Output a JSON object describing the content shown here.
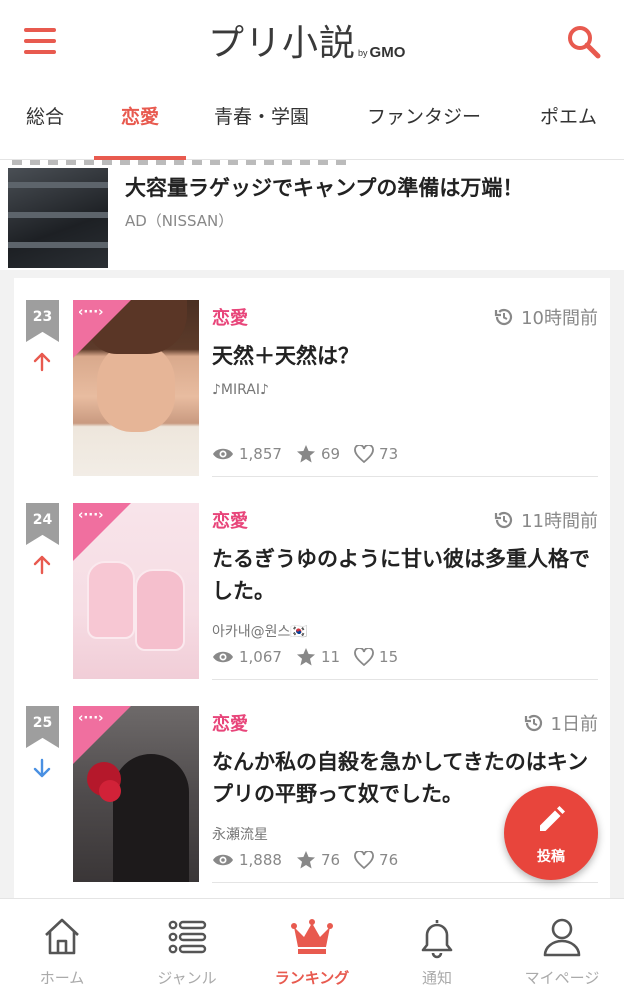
{
  "header": {
    "logo_text": "プリ小説",
    "logo_by": "by",
    "logo_brand": "GMO",
    "menu_icon": "hamburger-menu-icon",
    "search_icon": "search-icon"
  },
  "tabs": [
    {
      "label": "総合",
      "active": false
    },
    {
      "label": "恋愛",
      "active": true
    },
    {
      "label": "青春・学園",
      "active": false
    },
    {
      "label": "ファンタジー",
      "active": false
    },
    {
      "label": "ポエム",
      "active": false
    }
  ],
  "ad": {
    "title": "大容量ラゲッジでキャンプの準備は万端！",
    "source": "AD（NISSAN）"
  },
  "rankings": [
    {
      "rank": "23",
      "trend": "up",
      "category": "恋愛",
      "time": "10時間前",
      "title": "天然＋天然は？",
      "author": "♪MIRAI♪",
      "views": "1,857",
      "stars": "69",
      "likes": "73"
    },
    {
      "rank": "24",
      "trend": "up",
      "category": "恋愛",
      "time": "11時間前",
      "title": "たるぎうゆのように甘い彼は多重人格でした。",
      "author": "아카내@원스🇰🇷",
      "views": "1,067",
      "stars": "11",
      "likes": "15"
    },
    {
      "rank": "25",
      "trend": "down",
      "category": "恋愛",
      "time": "1日前",
      "title": "なんか私の自殺を急かしてきたのはキンプリの平野って奴でした。",
      "author": "永瀬流星",
      "views": "1,888",
      "stars": "76",
      "likes": "76"
    }
  ],
  "fab": {
    "label": "投稿",
    "icon": "pencil-icon"
  },
  "bottom_nav": [
    {
      "label": "ホーム",
      "icon": "home-icon",
      "active": false
    },
    {
      "label": "ジャンル",
      "icon": "list-icon",
      "active": false
    },
    {
      "label": "ランキング",
      "icon": "crown-icon",
      "active": true
    },
    {
      "label": "通知",
      "icon": "bell-icon",
      "active": false
    },
    {
      "label": "マイページ",
      "icon": "user-icon",
      "active": false
    }
  ],
  "colors": {
    "accent": "#e85a4f",
    "category": "#e8457a",
    "rank_badge": "#9e9e9e",
    "trend_up": "#e85a4f",
    "trend_down": "#4a90e2"
  }
}
